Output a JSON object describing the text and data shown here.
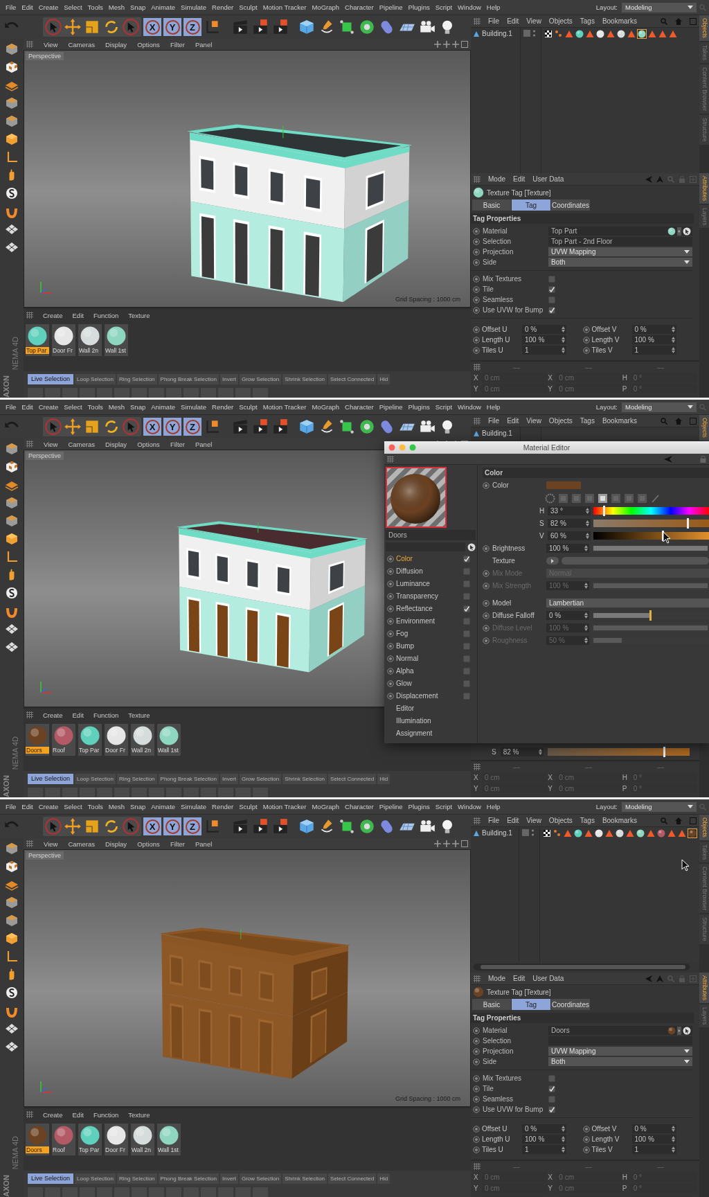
{
  "screens": [
    {
      "menu_bar": {
        "items": [
          "File",
          "Edit",
          "Create",
          "Select",
          "Tools",
          "Mesh",
          "Snap",
          "Animate",
          "Simulate",
          "Render",
          "Sculpt",
          "Motion Tracker",
          "MoGraph",
          "Character",
          "Pipeline",
          "Plugins",
          "Script",
          "Window",
          "Help"
        ],
        "layout_label": "Layout:",
        "layout_value": "Modeling"
      },
      "toolbar": {
        "axis_buttons": [
          {
            "label": "X",
            "selected": true
          },
          {
            "label": "Y",
            "selected": true
          },
          {
            "label": "Z",
            "selected": true
          }
        ]
      },
      "logo": [
        "AXON",
        "NEMA 4D"
      ],
      "viewport": {
        "menu": [
          "View",
          "Cameras",
          "Display",
          "Options",
          "Filter",
          "Panel"
        ],
        "camera": "Perspective",
        "grid_spacing": "Grid Spacing : 1000 cm",
        "building": {
          "kind": "teal-white"
        }
      },
      "material_manager": {
        "menu": [
          "Create",
          "Edit",
          "Function",
          "Texture"
        ],
        "materials": [
          {
            "name": "Top Par",
            "color": "#5fd0bb",
            "selected": true
          },
          {
            "name": "Door Fr",
            "color": "#e6e6e6",
            "selected": false
          },
          {
            "name": "Wall 2n",
            "color": "#d6dcdb",
            "selected": false
          },
          {
            "name": "Wall 1st",
            "color": "#8fd6c0",
            "selected": false
          }
        ]
      },
      "mode_bar": [
        {
          "label": "Live Selection",
          "selected": true
        },
        {
          "label": "Loop Selection",
          "selected": false
        },
        {
          "label": "Ring Selection",
          "selected": false
        },
        {
          "label": "Phong Break Selection",
          "selected": false
        },
        {
          "label": "Invert",
          "selected": false
        },
        {
          "label": "Grow Selection",
          "selected": false
        },
        {
          "label": "Shrink Selection",
          "selected": false
        },
        {
          "label": "Select Connected",
          "selected": false
        },
        {
          "label": "Hid",
          "selected": false
        }
      ],
      "objects": {
        "menu": [
          "File",
          "Edit",
          "View",
          "Objects",
          "Tags",
          "Bookmarks"
        ],
        "side_tabs": [
          {
            "label": "Objects",
            "selected": true
          },
          {
            "label": "Takes",
            "selected": false
          },
          {
            "label": "Content Browser",
            "selected": false
          },
          {
            "label": "Structure",
            "selected": false
          }
        ],
        "object": "Building.1",
        "tags": [
          {
            "kind": "checker",
            "selected": false
          },
          {
            "kind": "points",
            "selected": false
          },
          {
            "kind": "selection",
            "selected": false
          },
          {
            "kind": "texture",
            "color": "#5fd0bb",
            "selected": false
          },
          {
            "kind": "selection",
            "selected": false
          },
          {
            "kind": "texture",
            "color": "#e6e6e6",
            "selected": false
          },
          {
            "kind": "selection",
            "selected": false
          },
          {
            "kind": "texture",
            "color": "#d6dcdb",
            "selected": false
          },
          {
            "kind": "selection",
            "selected": false
          },
          {
            "kind": "texture",
            "color": "#8fd6c0",
            "selected": true
          },
          {
            "kind": "selection",
            "selected": false
          },
          {
            "kind": "selection",
            "selected": false
          },
          {
            "kind": "selection",
            "selected": false
          }
        ]
      },
      "attributes": {
        "menu": [
          "Mode",
          "Edit",
          "User Data"
        ],
        "side_tabs": [
          {
            "label": "Attributes",
            "selected": true
          },
          {
            "label": "Layers",
            "selected": false
          }
        ],
        "title": "Texture Tag [Texture]",
        "tabs": [
          {
            "label": "Basic",
            "selected": false
          },
          {
            "label": "Tag",
            "selected": true
          },
          {
            "label": "Coordinates",
            "selected": false
          }
        ],
        "section": "Tag Properties",
        "fields": [
          {
            "kind": "link",
            "label": "Material",
            "value": "Top Part"
          },
          {
            "kind": "text",
            "label": "Selection",
            "value": "Top Part - 2nd Floor"
          },
          {
            "kind": "dropdown",
            "label": "Projection",
            "value": "UVW Mapping"
          },
          {
            "kind": "dropdown",
            "label": "Side",
            "value": "Both"
          },
          {
            "kind": "checkbox",
            "label": "Mix Textures",
            "checked": false
          },
          {
            "kind": "checkbox",
            "label": "Tile",
            "checked": true
          },
          {
            "kind": "checkbox",
            "label": "Seamless",
            "checked": false
          },
          {
            "kind": "checkbox",
            "label": "Use UVW for Bump",
            "checked": true
          }
        ],
        "numbers": [
          {
            "label": "Offset U",
            "value": "0 %"
          },
          {
            "label": "Offset V",
            "value": "0 %"
          },
          {
            "label": "Length U",
            "value": "100 %"
          },
          {
            "label": "Length V",
            "value": "100 %"
          },
          {
            "label": "Tiles U",
            "value": "1"
          },
          {
            "label": "Tiles V",
            "value": "1"
          }
        ]
      },
      "coordinates": {
        "headers": [
          "—",
          "—",
          "—"
        ],
        "rows": [
          {
            "label": "X",
            "value": "0 cm"
          },
          {
            "label": "X",
            "value": "0 cm"
          },
          {
            "label": "H",
            "value": "0 °"
          },
          {
            "label": "Y",
            "value": "0 cm"
          },
          {
            "label": "Y",
            "value": "0 cm"
          },
          {
            "label": "P",
            "value": "0 °"
          }
        ]
      }
    },
    {
      "menu_bar": {
        "items": [
          "File",
          "Edit",
          "Create",
          "Select",
          "Tools",
          "Mesh",
          "Snap",
          "Animate",
          "Simulate",
          "Render",
          "Sculpt",
          "Motion Tracker",
          "MoGraph",
          "Character",
          "Pipeline",
          "Plugins",
          "Script",
          "Window",
          "Help"
        ],
        "layout_label": "Layout:",
        "layout_value": "Modeling"
      },
      "toolbar": {
        "axis_buttons": [
          {
            "label": "X",
            "selected": true
          },
          {
            "label": "Y",
            "selected": true
          },
          {
            "label": "Z",
            "selected": true
          }
        ]
      },
      "logo": [
        "AXON",
        "NEMA 4D"
      ],
      "viewport": {
        "menu": [
          "View",
          "Cameras",
          "Display",
          "Options",
          "Filter",
          "Panel"
        ],
        "camera": "Perspective",
        "building": {
          "kind": "teal-white-brown-doors"
        }
      },
      "material_manager": {
        "menu": [
          "Create",
          "Edit",
          "Function",
          "Texture"
        ],
        "materials": [
          {
            "name": "Doors",
            "color": "#6b4222",
            "selected": true
          },
          {
            "name": "Roof",
            "color": "#b45a66",
            "selected": false
          },
          {
            "name": "Top Par",
            "color": "#5fd0bb",
            "selected": false
          },
          {
            "name": "Door Fr",
            "color": "#e6e6e6",
            "selected": false
          },
          {
            "name": "Wall 2n",
            "color": "#d6dcdb",
            "selected": false
          },
          {
            "name": "Wall 1st",
            "color": "#8fd6c0",
            "selected": false
          }
        ]
      },
      "mode_bar": [
        {
          "label": "Live Selection",
          "selected": true
        },
        {
          "label": "Loop Selection",
          "selected": false
        },
        {
          "label": "Ring Selection",
          "selected": false
        },
        {
          "label": "Phong Break Selection",
          "selected": false
        },
        {
          "label": "Invert",
          "selected": false
        },
        {
          "label": "Grow Selection",
          "selected": false
        },
        {
          "label": "Shrink Selection",
          "selected": false
        },
        {
          "label": "Select Connected",
          "selected": false
        },
        {
          "label": "Hid",
          "selected": false
        }
      ],
      "objects": {
        "menu": [
          "File",
          "Edit",
          "View",
          "Objects",
          "Tags",
          "Bookmarks"
        ],
        "side_tabs": [
          {
            "label": "Objects",
            "selected": true
          }
        ],
        "object": "Building.1"
      },
      "attributes_peek": {
        "label": "S",
        "value": "82 %",
        "level": 0.82
      },
      "material_editor": {
        "title": "Material Editor",
        "name": "Doors",
        "channels": [
          {
            "kind": "channel",
            "label": "Color",
            "checked": true,
            "selected": true
          },
          {
            "kind": "channel",
            "label": "Diffusion",
            "checked": false,
            "selected": false
          },
          {
            "kind": "channel",
            "label": "Luminance",
            "checked": false,
            "selected": false
          },
          {
            "kind": "channel",
            "label": "Transparency",
            "checked": false,
            "selected": false
          },
          {
            "kind": "channel",
            "label": "Reflectance",
            "checked": true,
            "selected": false
          },
          {
            "kind": "channel",
            "label": "Environment",
            "checked": false,
            "selected": false
          },
          {
            "kind": "channel",
            "label": "Fog",
            "checked": false,
            "selected": false
          },
          {
            "kind": "channel",
            "label": "Bump",
            "checked": false,
            "selected": false
          },
          {
            "kind": "channel",
            "label": "Normal",
            "checked": false,
            "selected": false
          },
          {
            "kind": "channel",
            "label": "Alpha",
            "checked": false,
            "selected": false
          },
          {
            "kind": "channel",
            "label": "Glow",
            "checked": false,
            "selected": false
          },
          {
            "kind": "channel",
            "label": "Displacement",
            "checked": false,
            "selected": false
          },
          {
            "kind": "page",
            "label": "Editor",
            "selected": false
          },
          {
            "kind": "page",
            "label": "Illumination",
            "selected": false
          },
          {
            "kind": "page",
            "label": "Assignment",
            "selected": false
          }
        ],
        "section": "Color",
        "color_label": "Color",
        "hsv": [
          {
            "label": "H",
            "value": "33 °",
            "level": 0.092
          },
          {
            "label": "S",
            "value": "82 %",
            "level": 0.82
          },
          {
            "label": "V",
            "value": "60 %",
            "level": 0.6
          }
        ],
        "rows": [
          {
            "kind": "slider",
            "label": "Brightness",
            "value": "100 %",
            "level": 1,
            "disabled": false
          },
          {
            "kind": "texture",
            "label": "Texture",
            "disabled": false
          },
          {
            "kind": "dropdown",
            "label": "Mix Mode",
            "value": "Normal",
            "disabled": true
          },
          {
            "kind": "slider",
            "label": "Mix Strength",
            "value": "100 %",
            "level": 1,
            "disabled": true
          },
          {
            "kind": "dropdown",
            "label": "Model",
            "value": "Lambertian",
            "disabled": false
          },
          {
            "kind": "slider",
            "label": "Diffuse Falloff",
            "value": "0 %",
            "level": 0.5,
            "disabled": false
          },
          {
            "kind": "slider",
            "label": "Diffuse Level",
            "value": "100 %",
            "level": 1,
            "disabled": true
          },
          {
            "kind": "slider",
            "label": "Roughness",
            "value": "50 %",
            "level": 0.25,
            "disabled": true
          }
        ]
      },
      "coordinates": {
        "headers": [
          "—",
          "—",
          "—"
        ],
        "rows": [
          {
            "label": "X",
            "value": "0 cm"
          },
          {
            "label": "X",
            "value": "0 cm"
          },
          {
            "label": "H",
            "value": "0 °"
          },
          {
            "label": "Y",
            "value": "0 cm"
          },
          {
            "label": "Y",
            "value": "0 cm"
          },
          {
            "label": "P",
            "value": "0 °"
          }
        ]
      }
    },
    {
      "menu_bar": {
        "items": [
          "File",
          "Edit",
          "Create",
          "Select",
          "Tools",
          "Mesh",
          "Snap",
          "Animate",
          "Simulate",
          "Render",
          "Sculpt",
          "Motion Tracker",
          "MoGraph",
          "Character",
          "Pipeline",
          "Plugins",
          "Script",
          "Window",
          "Help"
        ],
        "layout_label": "Layout:",
        "layout_value": "Modeling"
      },
      "toolbar": {
        "axis_buttons": [
          {
            "label": "X",
            "selected": true
          },
          {
            "label": "Y",
            "selected": true
          },
          {
            "label": "Z",
            "selected": true
          }
        ]
      },
      "logo": [
        "AXON",
        "NEMA 4D"
      ],
      "viewport": {
        "menu": [
          "View",
          "Cameras",
          "Display",
          "Options",
          "Filter",
          "Panel"
        ],
        "camera": "Perspective",
        "grid_spacing": "Grid Spacing : 1000 cm",
        "building": {
          "kind": "brown"
        }
      },
      "material_manager": {
        "menu": [
          "Create",
          "Edit",
          "Function",
          "Texture"
        ],
        "materials": [
          {
            "name": "Doors",
            "color": "#6b4222",
            "selected": true
          },
          {
            "name": "Roof",
            "color": "#b45a66",
            "selected": false
          },
          {
            "name": "Top Par",
            "color": "#5fd0bb",
            "selected": false
          },
          {
            "name": "Door Fr",
            "color": "#e6e6e6",
            "selected": false
          },
          {
            "name": "Wall 2n",
            "color": "#d6dcdb",
            "selected": false
          },
          {
            "name": "Wall 1st",
            "color": "#8fd6c0",
            "selected": false
          }
        ]
      },
      "mode_bar": [
        {
          "label": "Live Selection",
          "selected": true
        },
        {
          "label": "Loop Selection",
          "selected": false
        },
        {
          "label": "Ring Selection",
          "selected": false
        },
        {
          "label": "Phong Break Selection",
          "selected": false
        },
        {
          "label": "Invert",
          "selected": false
        },
        {
          "label": "Grow Selection",
          "selected": false
        },
        {
          "label": "Shrink Selection",
          "selected": false
        },
        {
          "label": "Select Connected",
          "selected": false
        },
        {
          "label": "Hid",
          "selected": false
        }
      ],
      "objects": {
        "menu": [
          "File",
          "Edit",
          "View",
          "Objects",
          "Tags",
          "Bookmarks"
        ],
        "side_tabs": [
          {
            "label": "Objects",
            "selected": true
          },
          {
            "label": "Takes",
            "selected": false
          },
          {
            "label": "Content Browser",
            "selected": false
          },
          {
            "label": "Structure",
            "selected": false
          }
        ],
        "object": "Building.1",
        "h_scrollbar": true,
        "tags": [
          {
            "kind": "checker",
            "selected": false
          },
          {
            "kind": "points",
            "selected": false
          },
          {
            "kind": "selection",
            "selected": false
          },
          {
            "kind": "texture",
            "color": "#5fd0bb",
            "selected": false
          },
          {
            "kind": "selection",
            "selected": false
          },
          {
            "kind": "texture",
            "color": "#e6e6e6",
            "selected": false
          },
          {
            "kind": "selection",
            "selected": false
          },
          {
            "kind": "texture",
            "color": "#d6dcdb",
            "selected": false
          },
          {
            "kind": "selection",
            "selected": false
          },
          {
            "kind": "texture",
            "color": "#8fd6c0",
            "selected": false
          },
          {
            "kind": "selection",
            "selected": false
          },
          {
            "kind": "texture",
            "color": "#b45a66",
            "selected": false
          },
          {
            "kind": "selection",
            "selected": false
          },
          {
            "kind": "selection",
            "selected": false
          },
          {
            "kind": "texture",
            "color": "#6b4222",
            "selected": true
          }
        ]
      },
      "attributes": {
        "menu": [
          "Mode",
          "Edit",
          "User Data"
        ],
        "side_tabs": [
          {
            "label": "Attributes",
            "selected": true
          },
          {
            "label": "Layers",
            "selected": false
          }
        ],
        "title": "Texture Tag [Texture]",
        "tabs": [
          {
            "label": "Basic",
            "selected": false
          },
          {
            "label": "Tag",
            "selected": true
          },
          {
            "label": "Coordinates",
            "selected": false
          }
        ],
        "section": "Tag Properties",
        "fields": [
          {
            "kind": "link",
            "label": "Material",
            "value": "Doors"
          },
          {
            "kind": "text",
            "label": "Selection"
          },
          {
            "kind": "dropdown",
            "label": "Projection",
            "value": "UVW Mapping"
          },
          {
            "kind": "dropdown",
            "label": "Side",
            "value": "Both"
          },
          {
            "kind": "checkbox",
            "label": "Mix Textures",
            "checked": false
          },
          {
            "kind": "checkbox",
            "label": "Tile",
            "checked": true
          },
          {
            "kind": "checkbox",
            "label": "Seamless",
            "checked": false
          },
          {
            "kind": "checkbox",
            "label": "Use UVW for Bump",
            "checked": true
          }
        ],
        "numbers": [
          {
            "label": "Offset U",
            "value": "0 %"
          },
          {
            "label": "Offset V",
            "value": "0 %"
          },
          {
            "label": "Length U",
            "value": "100 %"
          },
          {
            "label": "Length V",
            "value": "100 %"
          },
          {
            "label": "Tiles U",
            "value": "1"
          },
          {
            "label": "Tiles V",
            "value": "1"
          }
        ]
      },
      "coordinates": {
        "headers": [
          "—",
          "—",
          "—"
        ],
        "rows": [
          {
            "label": "X",
            "value": "0 cm"
          },
          {
            "label": "X",
            "value": "0 cm"
          },
          {
            "label": "H",
            "value": "0 °"
          },
          {
            "label": "Y",
            "value": "0 cm"
          },
          {
            "label": "Y",
            "value": "0 cm"
          },
          {
            "label": "P",
            "value": "0 °"
          }
        ]
      }
    }
  ]
}
